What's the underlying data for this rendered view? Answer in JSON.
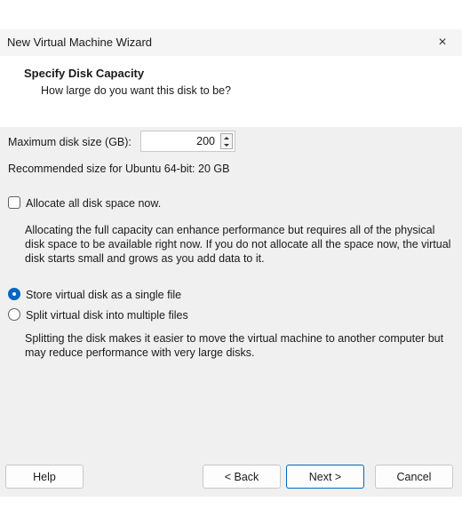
{
  "window": {
    "title": "New Virtual Machine Wizard",
    "close_label": "×"
  },
  "header": {
    "title": "Specify Disk Capacity",
    "subtitle": "How large do you want this disk to be?"
  },
  "disk_size": {
    "label": "Maximum disk size (GB):",
    "value": "200",
    "recommended": "Recommended size for Ubuntu 64-bit: 20 GB"
  },
  "allocate": {
    "label": "Allocate all disk space now.",
    "checked": false,
    "description": "Allocating the full capacity can enhance performance but requires all of the physical disk space to be available right now. If you do not allocate all the space now, the virtual disk starts small and grows as you add data to it."
  },
  "storage_options": [
    {
      "label": "Store virtual disk as a single file",
      "selected": true
    },
    {
      "label": "Split virtual disk into multiple files",
      "selected": false
    }
  ],
  "split_description": "Splitting the disk makes it easier to move the virtual machine to another computer but may reduce performance with very large disks.",
  "buttons": {
    "help": "Help",
    "back": "< Back",
    "next": "Next >",
    "cancel": "Cancel"
  },
  "colors": {
    "accent": "#0067c0",
    "dialog_bg": "#f0f0f0",
    "header_bg": "#ffffff"
  }
}
